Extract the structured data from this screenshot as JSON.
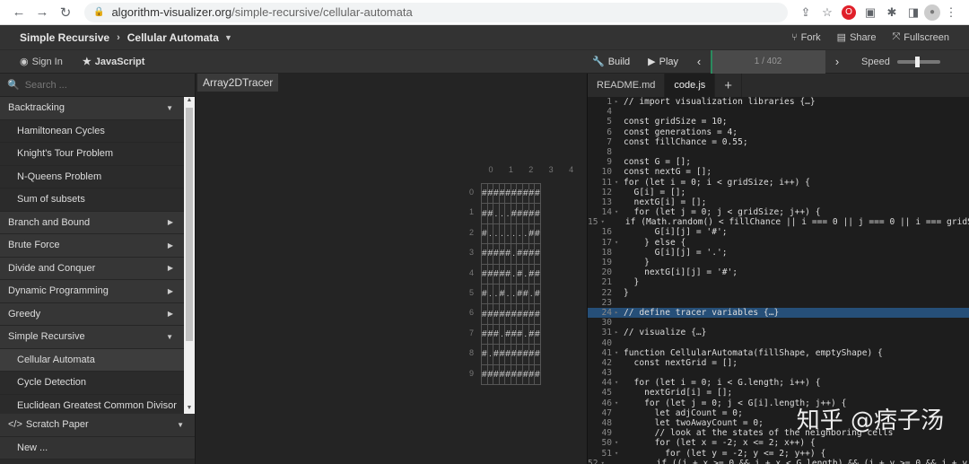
{
  "browser": {
    "url_host": "algorithm-visualizer.org",
    "url_path": "/simple-recursive/cellular-automata"
  },
  "header": {
    "category": "Simple Recursive",
    "title": "Cellular Automata",
    "fork": "Fork",
    "share": "Share",
    "fullscreen": "Fullscreen"
  },
  "toolbar": {
    "sign_in": "Sign In",
    "language": "JavaScript",
    "build": "Build",
    "play": "Play",
    "progress": "1 / 402",
    "speed": "Speed"
  },
  "sidebar": {
    "search_placeholder": "Search ...",
    "items": [
      {
        "label": "Backtracking",
        "kind": "cat",
        "arrow": "▼"
      },
      {
        "label": "Hamiltonean Cycles",
        "kind": "sub"
      },
      {
        "label": "Knight's Tour Problem",
        "kind": "sub"
      },
      {
        "label": "N-Queens Problem",
        "kind": "sub"
      },
      {
        "label": "Sum of subsets",
        "kind": "sub"
      },
      {
        "label": "Branch and Bound",
        "kind": "cat",
        "arrow": "▶"
      },
      {
        "label": "Brute Force",
        "kind": "cat",
        "arrow": "▶"
      },
      {
        "label": "Divide and Conquer",
        "kind": "cat",
        "arrow": "▶"
      },
      {
        "label": "Dynamic Programming",
        "kind": "cat",
        "arrow": "▶"
      },
      {
        "label": "Greedy",
        "kind": "cat",
        "arrow": "▶"
      },
      {
        "label": "Simple Recursive",
        "kind": "cat",
        "arrow": "▼"
      },
      {
        "label": "Cellular Automata",
        "kind": "sub",
        "active": true
      },
      {
        "label": "Cycle Detection",
        "kind": "sub"
      },
      {
        "label": "Euclidean Greatest Common Divisor",
        "kind": "sub"
      }
    ],
    "scratch_paper": "Scratch Paper",
    "new": "New ..."
  },
  "tracer": {
    "label": "Array2DTracer",
    "columns": [
      "0",
      "1",
      "2",
      "3",
      "4",
      "5",
      "6",
      "7",
      "8",
      "9"
    ],
    "rows": [
      [
        "#",
        "#",
        "#",
        "#",
        "#",
        "#",
        "#",
        "#",
        "#",
        "#"
      ],
      [
        "#",
        "#",
        ".",
        ".",
        ".",
        "#",
        "#",
        "#",
        "#",
        "#"
      ],
      [
        "#",
        ".",
        ".",
        ".",
        ".",
        ".",
        ".",
        ".",
        "#",
        "#"
      ],
      [
        "#",
        "#",
        "#",
        "#",
        "#",
        ".",
        "#",
        "#",
        "#",
        "#"
      ],
      [
        "#",
        "#",
        "#",
        "#",
        "#",
        ".",
        "#",
        ".",
        "#",
        "#"
      ],
      [
        "#",
        ".",
        ".",
        "#",
        ".",
        ".",
        "#",
        "#",
        ".",
        "#"
      ],
      [
        "#",
        "#",
        "#",
        "#",
        "#",
        "#",
        "#",
        "#",
        "#",
        "#"
      ],
      [
        "#",
        "#",
        "#",
        ".",
        "#",
        "#",
        "#",
        ".",
        "#",
        "#"
      ],
      [
        "#",
        ".",
        "#",
        "#",
        "#",
        "#",
        "#",
        "#",
        "#",
        "#"
      ],
      [
        "#",
        "#",
        "#",
        "#",
        "#",
        "#",
        "#",
        "#",
        "#",
        "#"
      ]
    ]
  },
  "editor": {
    "tabs": [
      "README.md",
      "code.js"
    ],
    "lines": [
      {
        "n": "1",
        "f": "▸",
        "t": "// import visualization libraries {…}"
      },
      {
        "n": "4",
        "f": "",
        "t": ""
      },
      {
        "n": "5",
        "f": "",
        "t": "const gridSize = 10;"
      },
      {
        "n": "6",
        "f": "",
        "t": "const generations = 4;"
      },
      {
        "n": "7",
        "f": "",
        "t": "const fillChance = 0.55;"
      },
      {
        "n": "8",
        "f": "",
        "t": ""
      },
      {
        "n": "9",
        "f": "",
        "t": "const G = [];"
      },
      {
        "n": "10",
        "f": "",
        "t": "const nextG = [];"
      },
      {
        "n": "11",
        "f": "▾",
        "t": "for (let i = 0; i < gridSize; i++) {"
      },
      {
        "n": "12",
        "f": "",
        "t": "  G[i] = [];"
      },
      {
        "n": "13",
        "f": "",
        "t": "  nextG[i] = [];"
      },
      {
        "n": "14",
        "f": "▾",
        "t": "  for (let j = 0; j < gridSize; j++) {"
      },
      {
        "n": "15",
        "f": "▾",
        "t": "    if (Math.random() < fillChance || i === 0 || j === 0 || i === gridSiz"
      },
      {
        "n": "16",
        "f": "",
        "t": "      G[i][j] = '#';"
      },
      {
        "n": "17",
        "f": "▾",
        "t": "    } else {"
      },
      {
        "n": "18",
        "f": "",
        "t": "      G[i][j] = '.';"
      },
      {
        "n": "19",
        "f": "",
        "t": "    }"
      },
      {
        "n": "20",
        "f": "",
        "t": "    nextG[i][j] = '#';"
      },
      {
        "n": "21",
        "f": "",
        "t": "  }"
      },
      {
        "n": "22",
        "f": "",
        "t": "}"
      },
      {
        "n": "23",
        "f": "",
        "t": ""
      },
      {
        "n": "24",
        "f": "▸",
        "t": "// define tracer variables {…}",
        "hl": true
      },
      {
        "n": "30",
        "f": "",
        "t": ""
      },
      {
        "n": "31",
        "f": "▸",
        "t": "// visualize {…}"
      },
      {
        "n": "40",
        "f": "",
        "t": ""
      },
      {
        "n": "41",
        "f": "▾",
        "t": "function CellularAutomata(fillShape, emptyShape) {"
      },
      {
        "n": "42",
        "f": "",
        "t": "  const nextGrid = [];"
      },
      {
        "n": "43",
        "f": "",
        "t": ""
      },
      {
        "n": "44",
        "f": "▾",
        "t": "  for (let i = 0; i < G.length; i++) {"
      },
      {
        "n": "45",
        "f": "",
        "t": "    nextGrid[i] = [];"
      },
      {
        "n": "46",
        "f": "▾",
        "t": "    for (let j = 0; j < G[i].length; j++) {"
      },
      {
        "n": "47",
        "f": "",
        "t": "      let adjCount = 0;"
      },
      {
        "n": "48",
        "f": "",
        "t": "      let twoAwayCount = 0;"
      },
      {
        "n": "49",
        "f": "",
        "t": "      // look at the states of the neighboring cells"
      },
      {
        "n": "50",
        "f": "▾",
        "t": "      for (let x = -2; x <= 2; x++) {"
      },
      {
        "n": "51",
        "f": "▾",
        "t": "        for (let y = -2; y <= 2; y++) {"
      },
      {
        "n": "52",
        "f": "▾",
        "t": "          if ((i + x >= 0 && i + x < G.length) && (j + y >= 0 && j + y < G"
      }
    ]
  },
  "watermark": "知乎 @痞子汤"
}
